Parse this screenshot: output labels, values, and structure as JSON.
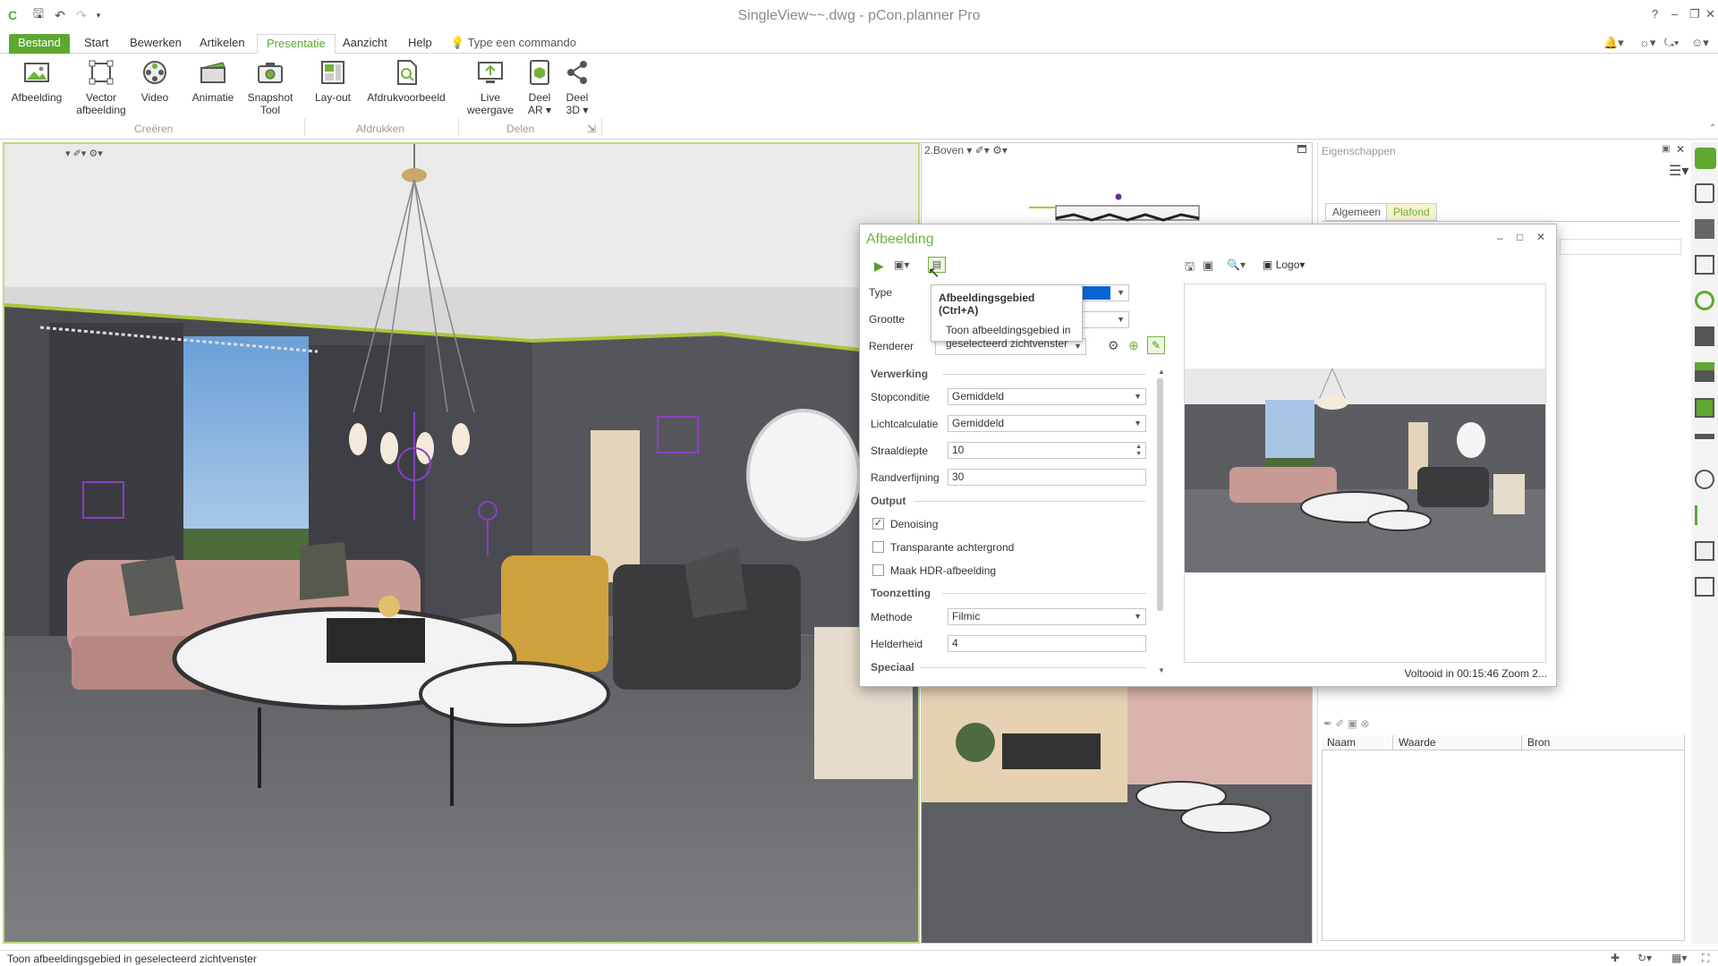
{
  "window": {
    "title": "SingleView~~.dwg - pCon.planner Pro",
    "help": "?",
    "minimize": "–",
    "restore": "❐",
    "close": "✕"
  },
  "tabs": [
    "Bestand",
    "Start",
    "Bewerken",
    "Artikelen",
    "Presentatie",
    "Aanzicht",
    "Help"
  ],
  "command_search": "Type een commando",
  "ribbon": {
    "buttons": [
      "Afbeelding",
      "Vector\nafbeelding",
      "Video",
      "Animatie",
      "Snapshot\nTool",
      "Lay-out",
      "Afdrukvoorbeeld",
      "Live\nweergave",
      "Deel\nAR ▾",
      "Deel\n3D ▾"
    ],
    "groups": [
      "Creëren",
      "Afdrukken",
      "Delen"
    ]
  },
  "viewport_top": {
    "label": "2.Boven"
  },
  "properties": {
    "title": "Eigenschappen",
    "tabs": [
      "Algemeen",
      "Plafond"
    ],
    "columns": [
      "Naam",
      "Waarde",
      "Bron"
    ]
  },
  "dialog": {
    "title": "Afbeelding",
    "logo_label": "Logo",
    "labels": {
      "type": "Type",
      "grootte": "Grootte",
      "renderer": "Renderer"
    },
    "sections": [
      "Verwerking",
      "Output",
      "Toonzetting",
      "Speciaal"
    ],
    "fields": {
      "stopconditie": {
        "label": "Stopconditie",
        "value": "Gemiddeld"
      },
      "lichtcalculatie": {
        "label": "Lichtcalculatie",
        "value": "Gemiddeld"
      },
      "straaldiepte": {
        "label": "Straaldiepte",
        "value": "10"
      },
      "randverfijning": {
        "label": "Randverfijning",
        "value": "30"
      },
      "methode": {
        "label": "Methode",
        "value": "Filmic"
      },
      "helderheid": {
        "label": "Helderheid",
        "value": "4"
      }
    },
    "checkboxes": [
      {
        "label": "Denoising",
        "checked": true
      },
      {
        "label": "Transparante achtergrond",
        "checked": false
      },
      {
        "label": "Maak HDR-afbeelding",
        "checked": false
      }
    ],
    "status": "Voltooid in 00:15:46 Zoom 2..."
  },
  "tooltip": {
    "title": "Afbeeldingsgebied (Ctrl+A)",
    "desc": "Toon afbeeldingsgebied in geselecteerd zichtvenster"
  },
  "statusbar": "Toon afbeeldingsgebied in geselecteerd zichtvenster",
  "colors": {
    "accent": "#5ea830",
    "selection": "#0a64d6"
  }
}
